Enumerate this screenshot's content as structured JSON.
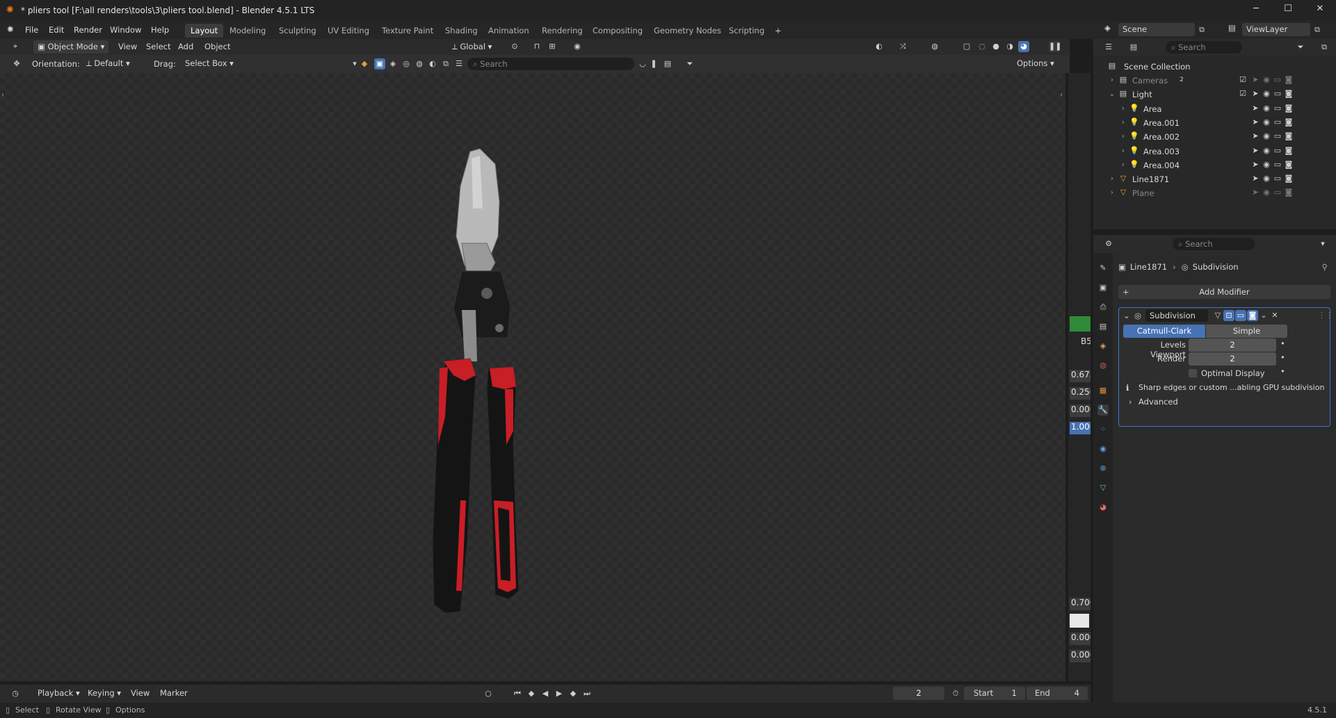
{
  "window": {
    "title": "* pliers tool [F:\\all renders\\tools\\3\\pliers tool.blend] - Blender 4.5.1 LTS",
    "minimize": "─",
    "maximize": "☐",
    "close": "✕"
  },
  "menu": [
    "File",
    "Edit",
    "Render",
    "Window",
    "Help"
  ],
  "workspaces": [
    "Layout",
    "Modeling",
    "Sculpting",
    "UV Editing",
    "Texture Paint",
    "Shading",
    "Animation",
    "Rendering",
    "Compositing",
    "Geometry Nodes",
    "Scripting",
    "+"
  ],
  "scene": {
    "name": "Scene",
    "viewlayer": "ViewLayer"
  },
  "header3d": {
    "mode": "Object Mode",
    "menus": [
      "View",
      "Select",
      "Add",
      "Object"
    ],
    "transform": "Global"
  },
  "tool3d": {
    "orientation_label": "Orientation:",
    "orientation": "Default",
    "drag_label": "Drag:",
    "drag": "Select Box",
    "search_placeholder": "Search",
    "options": "Options"
  },
  "npanel_values": [
    "B5",
    "0.673",
    "0.250",
    "0.000",
    "1.000",
    "0.700",
    "0.000",
    "0.000"
  ],
  "outliner": {
    "search_placeholder": "Search",
    "root": "Scene Collection",
    "rows": [
      {
        "label": "Cameras",
        "badge": "2",
        "dim": true,
        "indent": 0
      },
      {
        "label": "Light",
        "indent": 0
      },
      {
        "label": "Area",
        "indent": 1
      },
      {
        "label": "Area.001",
        "indent": 1
      },
      {
        "label": "Area.002",
        "indent": 1
      },
      {
        "label": "Area.003",
        "indent": 1
      },
      {
        "label": "Area.004",
        "indent": 1
      },
      {
        "label": "Line1871",
        "indent": 0
      },
      {
        "label": "Plane",
        "dim": true,
        "indent": 0
      }
    ]
  },
  "properties": {
    "search_placeholder": "Search",
    "breadcrumb_object": "Line1871",
    "breadcrumb_modifier": "Subdivision",
    "add_modifier": "Add Modifier",
    "modifier": {
      "name": "Subdivision",
      "mode_a": "Catmull-Clark",
      "mode_b": "Simple",
      "levels_viewport_label": "Levels Viewport",
      "levels_viewport": "2",
      "render_label": "Render",
      "render": "2",
      "optimal_display": "Optimal Display",
      "warning": "Sharp edges or custom ...abling GPU subdivision",
      "advanced": "Advanced"
    }
  },
  "timeline": {
    "menus": [
      "Playback",
      "Keying",
      "View",
      "Marker"
    ],
    "current_frame": "2",
    "start_label": "Start",
    "start": "1",
    "end_label": "End",
    "end": "4"
  },
  "status": {
    "select": "Select",
    "rotate": "Rotate View",
    "options": "Options",
    "version": "4.5.1"
  },
  "colors": {
    "accent": "#4772b3",
    "handle_red": "#c81e26",
    "handle_black": "#141414",
    "metal": "#b9b9b9"
  }
}
